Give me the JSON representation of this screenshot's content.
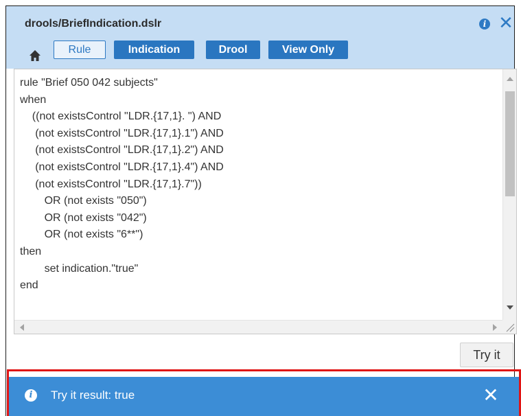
{
  "header": {
    "title": "drools/BriefIndication.dslr",
    "info_icon": "i",
    "close_icon": "✕"
  },
  "toolbar": {
    "home_icon": "home-icon",
    "rule_label": "Rule",
    "indication_label": "Indication",
    "drool_label": "Drool",
    "view_only_label": "View Only"
  },
  "editor": {
    "code": "rule \"Brief 050 042 subjects\"\nwhen\n    ((not existsControl \"LDR.{17,1}. \") AND\n     (not existsControl \"LDR.{17,1}.1\") AND\n     (not existsControl \"LDR.{17,1}.2\") AND\n     (not existsControl \"LDR.{17,1}.4\") AND\n     (not existsControl \"LDR.{17,1}.7\"))\n        OR (not exists \"050\")\n        OR (not exists \"042\")\n        OR (not exists \"6**\")\nthen\n        set indication.\"true\"\nend"
  },
  "actions": {
    "try_label": "Try it"
  },
  "result": {
    "info_icon": "i",
    "text": "Try it result: true",
    "close_icon": "✕"
  },
  "colors": {
    "header_bg": "#c5ddf4",
    "accent": "#2a76c0",
    "result_bg": "#3c8dd6",
    "highlight_border": "#e01515"
  }
}
